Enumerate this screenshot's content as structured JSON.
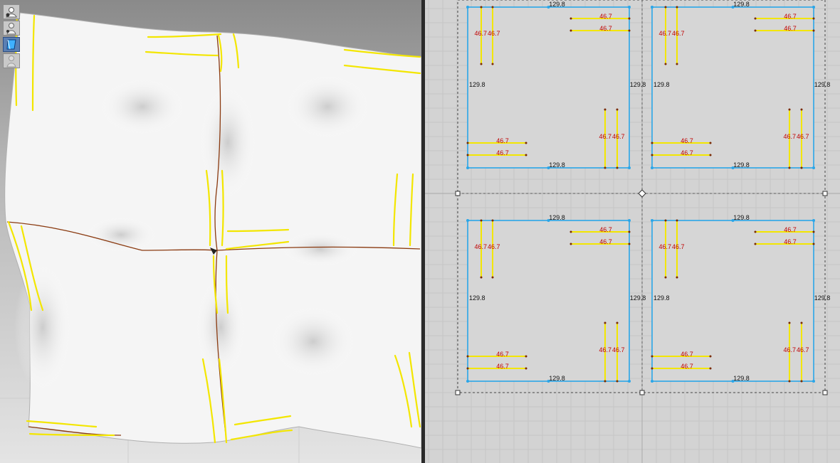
{
  "panels": {
    "left_view": "3d-simulation",
    "right_view": "2d-pattern"
  },
  "toolbar": {
    "tools": [
      {
        "icon": "avatar-eye-icon",
        "active": false
      },
      {
        "icon": "avatar-hide-icon",
        "active": false
      },
      {
        "icon": "fabric-icon",
        "active": true
      },
      {
        "icon": "avatar-ghost-icon",
        "active": false
      }
    ]
  },
  "pattern": {
    "pieces": [
      {
        "id": "top-left",
        "edge_top": "129.8",
        "edge_bottom": "129.8",
        "edge_left": "129.8",
        "edge_right": "129.8",
        "strap_tl_a": "46.7",
        "strap_tl_b": "46.7",
        "strap_tr_a": "46.7",
        "strap_tr_b": "46.7",
        "strap_bl_a": "46.7",
        "strap_bl_b": "46.7",
        "strap_br_a": "46.7",
        "strap_br_b": "46.7"
      },
      {
        "id": "top-right",
        "edge_top": "129.8",
        "edge_bottom": "129.8",
        "edge_left": "129.8",
        "edge_right": "129.8",
        "strap_tl_a": "46.7",
        "strap_tl_b": "46.7",
        "strap_tr_a": "46.7",
        "strap_tr_b": "46.7",
        "strap_bl_a": "46.7",
        "strap_bl_b": "46.7",
        "strap_br_a": "46.7",
        "strap_br_b": "46.7"
      },
      {
        "id": "bottom-left",
        "edge_top": "129.8",
        "edge_bottom": "129.8",
        "edge_left": "129.8",
        "edge_right": "129.8",
        "strap_tl_a": "46.7",
        "strap_tl_b": "46.7",
        "strap_tr_a": "46.7",
        "strap_tr_b": "46.7",
        "strap_bl_a": "46.7",
        "strap_bl_b": "46.7",
        "strap_br_a": "46.7",
        "strap_br_b": "46.7"
      },
      {
        "id": "bottom-right",
        "edge_top": "129.8",
        "edge_bottom": "129.8",
        "edge_left": "129.8",
        "edge_right": "129.8",
        "strap_tl_a": "46.7",
        "strap_tl_b": "46.7",
        "strap_tr_a": "46.7",
        "strap_tr_b": "46.7",
        "strap_bl_a": "46.7",
        "strap_bl_b": "46.7",
        "strap_br_a": "46.7",
        "strap_br_b": "46.7"
      }
    ]
  },
  "colors": {
    "outline": "#2aa6e8",
    "strap": "#f3e600",
    "dim_red": "#c00000",
    "fabric": "#f4f4f4",
    "grid_bg": "#d3d3d3",
    "grid_line": "#c4c4c4"
  }
}
